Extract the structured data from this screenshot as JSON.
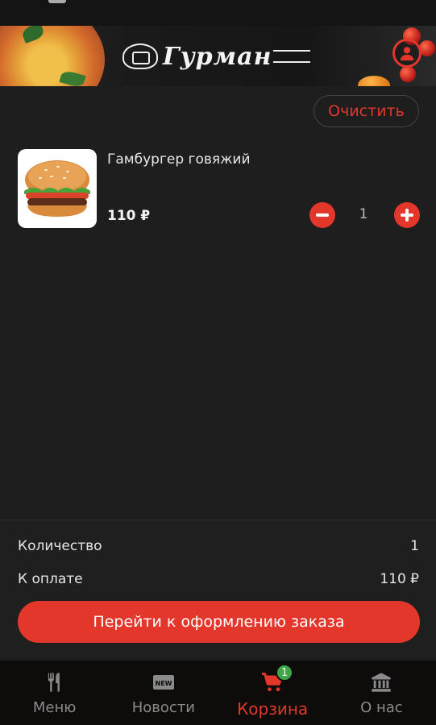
{
  "header": {
    "logo_text": "Гурман",
    "profile_icon": "user-icon"
  },
  "cart": {
    "clear_label": "Очистить",
    "items": [
      {
        "name": "Гамбургер говяжий",
        "price": "110 ₽",
        "quantity": "1",
        "image": "hamburger-photo"
      }
    ]
  },
  "summary": {
    "quantity_label": "Количество",
    "quantity_value": "1",
    "total_label": "К оплате",
    "total_value": "110 ₽",
    "checkout_label": "Перейти к оформлению заказа"
  },
  "tabbar": {
    "tabs": [
      {
        "label": "Меню",
        "icon": "fork-knife-icon"
      },
      {
        "label": "Новости",
        "icon": "new-badge-icon"
      },
      {
        "label": "Корзина",
        "icon": "cart-icon",
        "badge": "1",
        "active": true
      },
      {
        "label": "О нас",
        "icon": "bank-icon"
      }
    ]
  },
  "colors": {
    "accent": "#e2372a",
    "background": "#1e1e1e",
    "tabbar_bg": "#0e0b0b",
    "badge": "#3fa648"
  }
}
